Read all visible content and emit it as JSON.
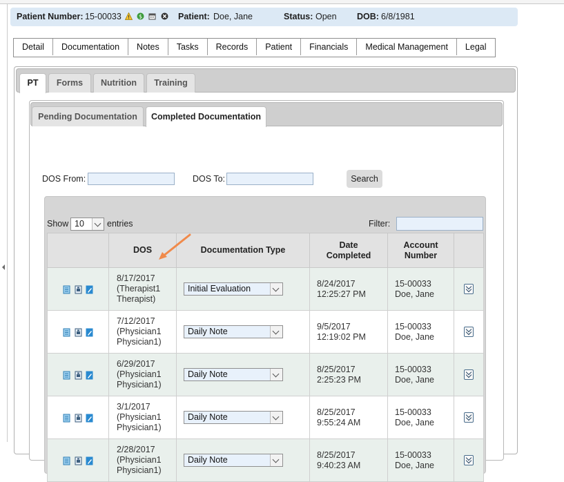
{
  "patient": {
    "number_label": "Patient Number:",
    "number": "15-00033",
    "patient_label": "Patient:",
    "name": "Doe, Jane",
    "status_label": "Status:",
    "status": "Open",
    "dob_label": "DOB:",
    "dob": "6/8/1981"
  },
  "main_tabs": [
    "Detail",
    "Documentation",
    "Notes",
    "Tasks",
    "Records",
    "Patient",
    "Financials",
    "Medical Management",
    "Legal"
  ],
  "pt_tabs": [
    "PT",
    "Forms",
    "Nutrition",
    "Training"
  ],
  "doc_tabs": [
    "Pending Documentation",
    "Completed Documentation"
  ],
  "filters": {
    "dos_from_label": "DOS From:",
    "dos_to_label": "DOS To:",
    "search_label": "Search"
  },
  "grid": {
    "show_label": "Show",
    "page_length": "10",
    "entries_label": "entries",
    "filter_label": "Filter:",
    "headers": {
      "dos": "DOS",
      "doc_type": "Documentation Type",
      "date_completed_1": "Date",
      "date_completed_2": "Completed",
      "account_1": "Account",
      "account_2": "Number"
    },
    "rows": [
      {
        "dos": "8/17/2017",
        "provider_1": "(Therapist1",
        "provider_2": "Therapist)",
        "doc_type": "Initial Evaluation",
        "completed_date": "8/24/2017",
        "completed_time": "12:25:27 PM",
        "account": "15-00033",
        "account_name": "Doe, Jane"
      },
      {
        "dos": "7/12/2017",
        "provider_1": "(Physician1",
        "provider_2": "Physician1)",
        "doc_type": "Daily Note",
        "completed_date": "9/5/2017",
        "completed_time": "12:19:02 PM",
        "account": "15-00033",
        "account_name": "Doe, Jane"
      },
      {
        "dos": "6/29/2017",
        "provider_1": "(Physician1",
        "provider_2": "Physician1)",
        "doc_type": "Daily Note",
        "completed_date": "8/25/2017",
        "completed_time": "2:25:23 PM",
        "account": "15-00033",
        "account_name": "Doe, Jane"
      },
      {
        "dos": "3/1/2017",
        "provider_1": "(Physician1",
        "provider_2": "Physician1)",
        "doc_type": "Daily Note",
        "completed_date": "8/25/2017",
        "completed_time": "9:55:24 AM",
        "account": "15-00033",
        "account_name": "Doe, Jane"
      },
      {
        "dos": "2/28/2017",
        "provider_1": "(Physician1",
        "provider_2": "Physician1)",
        "doc_type": "Daily Note",
        "completed_date": "8/25/2017",
        "completed_time": "9:40:23 AM",
        "account": "15-00033",
        "account_name": "Doe, Jane"
      }
    ]
  },
  "colors": {
    "patient_bar": "#dce9f5",
    "row_alt": "#e9f0ec",
    "annotation_arrow": "#f08a4b"
  }
}
